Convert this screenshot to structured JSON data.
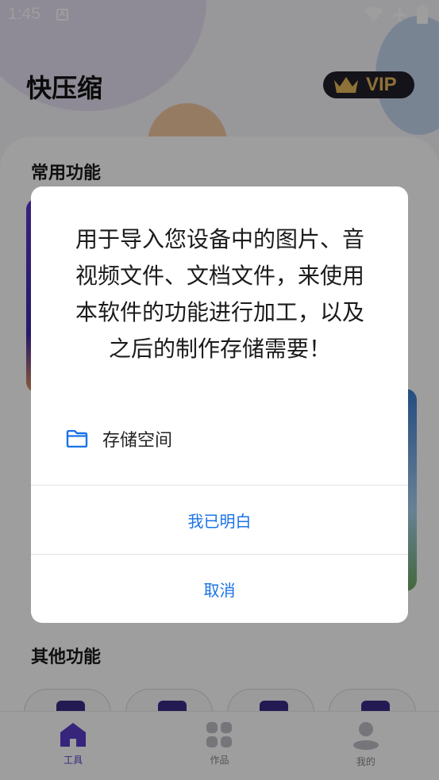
{
  "status_bar": {
    "time": "1:45",
    "notification_icon": "A"
  },
  "app": {
    "title": "快压缩",
    "vip_label": "VIP",
    "section_common": "常用功能",
    "section_other": "其他功能"
  },
  "bottom_nav": {
    "items": [
      {
        "label": "工具",
        "icon": "tools-icon",
        "active": true
      },
      {
        "label": "作品",
        "icon": "works-icon",
        "active": false
      },
      {
        "label": "我的",
        "icon": "profile-icon",
        "active": false
      }
    ]
  },
  "dialog": {
    "message": "用于导入您设备中的图片、音视频文件、文档文件，来使用本软件的功能进行加工，以及之后的制作存储需要！",
    "permission_label": "存储空间",
    "permission_icon": "folder-icon",
    "confirm_label": "我已明白",
    "cancel_label": "取消"
  },
  "colors": {
    "accent_button": "#1a73e8",
    "brand_purple": "#5a3cc9",
    "vip_gold": "#e5b659"
  }
}
